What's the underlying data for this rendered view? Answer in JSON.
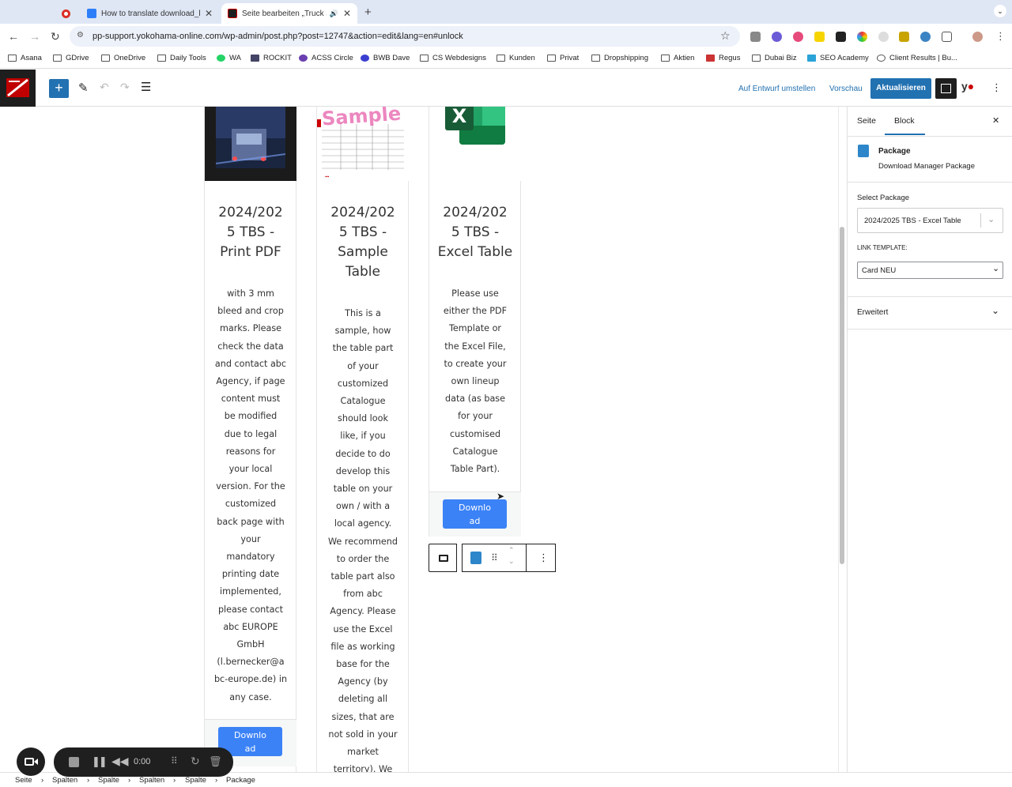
{
  "browser": {
    "tabs": [
      {
        "title": "How to translate download_li"
      },
      {
        "title": "Seite bearbeiten „Truck ai"
      }
    ],
    "url": "pp-support.yokohama-online.com/wp-admin/post.php?post=12747&action=edit&lang=en#unlock",
    "bookmarks": [
      "Asana",
      "GDrive",
      "OneDrive",
      "Daily Tools",
      "WA",
      "ROCKIT",
      "ACSS Circle",
      "BWB Dave",
      "CS Webdesigns",
      "Kunden",
      "Privat",
      "Dropshipping",
      "Aktien",
      "Regus",
      "Dubai Biz",
      "SEO Academy",
      "Client Results | Bu..."
    ]
  },
  "editor": {
    "switch_draft": "Auf Entwurf umstellen",
    "preview": "Vorschau",
    "update": "Aktualisieren",
    "plus": "+"
  },
  "columns": [
    {
      "title": "2024/202\n5 TBS -\nPrint PDF",
      "text": "with 3 mm\nbleed and crop\nmarks. Please\ncheck the data\nand contact abc\nAgency, if page\ncontent must\nbe modified\ndue to legal\nreasons for\nyour local\nversion. For the\ncustomized\nback page with\nyour\nmandatory\nprinting date\nimplemented,\nplease contact\nabc EUROPE\nGmbH\n(l.bernecker@a\nbc-europe.de) in\nany case.",
      "button": "Downlo\nad"
    },
    {
      "title": "2024/202\n5 TBS -\nSample\nTable",
      "thumb_text": "Sample",
      "text": "This is a\nsample, how\nthe table part\nof your\ncustomized\nCatalogue\nshould look\nlike, if you\ndecide to do\ndevelop this\ntable on your\nown / with a\nlocal agency.\nWe recommend\nto order the\ntable part also\nfrom abc\nAgency. Please\nuse the Excel\nfile as working\nbase for the\nAgency (by\ndeleting all\nsizes, that are\nnot sold in your\nmarket\nterritory). We"
    },
    {
      "title": "2024/202\n5 TBS -\nExcel Table",
      "thumb_text": "X",
      "text": "Please use\neither the PDF\nTemplate or\nthe Excel File,\nto create your\nown lineup\ndata (as base\nfor your\ncustomised\nCatalogue\nTable Part).",
      "button": "Downlo\nad"
    }
  ],
  "sidebar": {
    "tab_page": "Seite",
    "tab_block": "Block",
    "close": "✕",
    "block_name": "Package",
    "block_desc": "Download Manager Package",
    "select_label": "Select Package",
    "select_value": "2024/2025 TBS - Excel Table",
    "template_label": "LINK TEMPLATE:",
    "template_value": "Card NEU",
    "advanced": "Erweitert"
  },
  "breadcrumb": [
    "Seite",
    "Spalten",
    "Spalte",
    "Spalten",
    "Spalte",
    "Package"
  ],
  "recorder": {
    "time": "0:00"
  },
  "colors": {
    "wp_blue": "#2271b1",
    "download_blue": "#3b82f6",
    "excel_green": "#1d7044"
  }
}
